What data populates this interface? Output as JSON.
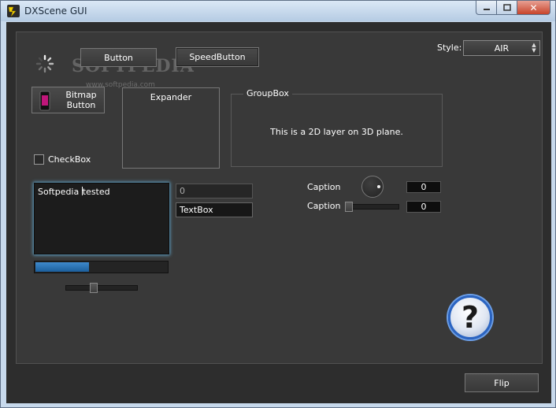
{
  "window": {
    "title": "DXScene GUI"
  },
  "watermark": {
    "brand": "SOFTPEDIA",
    "url": "www.softpedia.com"
  },
  "buttons": {
    "button": "Button",
    "speed_button": "SpeedButton",
    "bitmap_button": "Bitmap Button",
    "flip": "Flip"
  },
  "style_select": {
    "label": "Style:",
    "value": "AIR"
  },
  "expander": {
    "title": "Expander"
  },
  "groupbox": {
    "title": "GroupBox",
    "text": "This is a 2D layer on 3D plane."
  },
  "checkbox": {
    "label": "CheckBox",
    "checked": false
  },
  "memo": {
    "text_before_caret": "Softpedia ",
    "text_after_caret": "tested"
  },
  "numeric_field": {
    "value": "0"
  },
  "textbox": {
    "value": "TextBox"
  },
  "progress": {
    "value": 0.41
  },
  "slider": {
    "value": 0.38
  },
  "caption_knob": {
    "label": "Caption",
    "value": "0"
  },
  "caption_slider": {
    "label": "Caption",
    "value": "0"
  }
}
